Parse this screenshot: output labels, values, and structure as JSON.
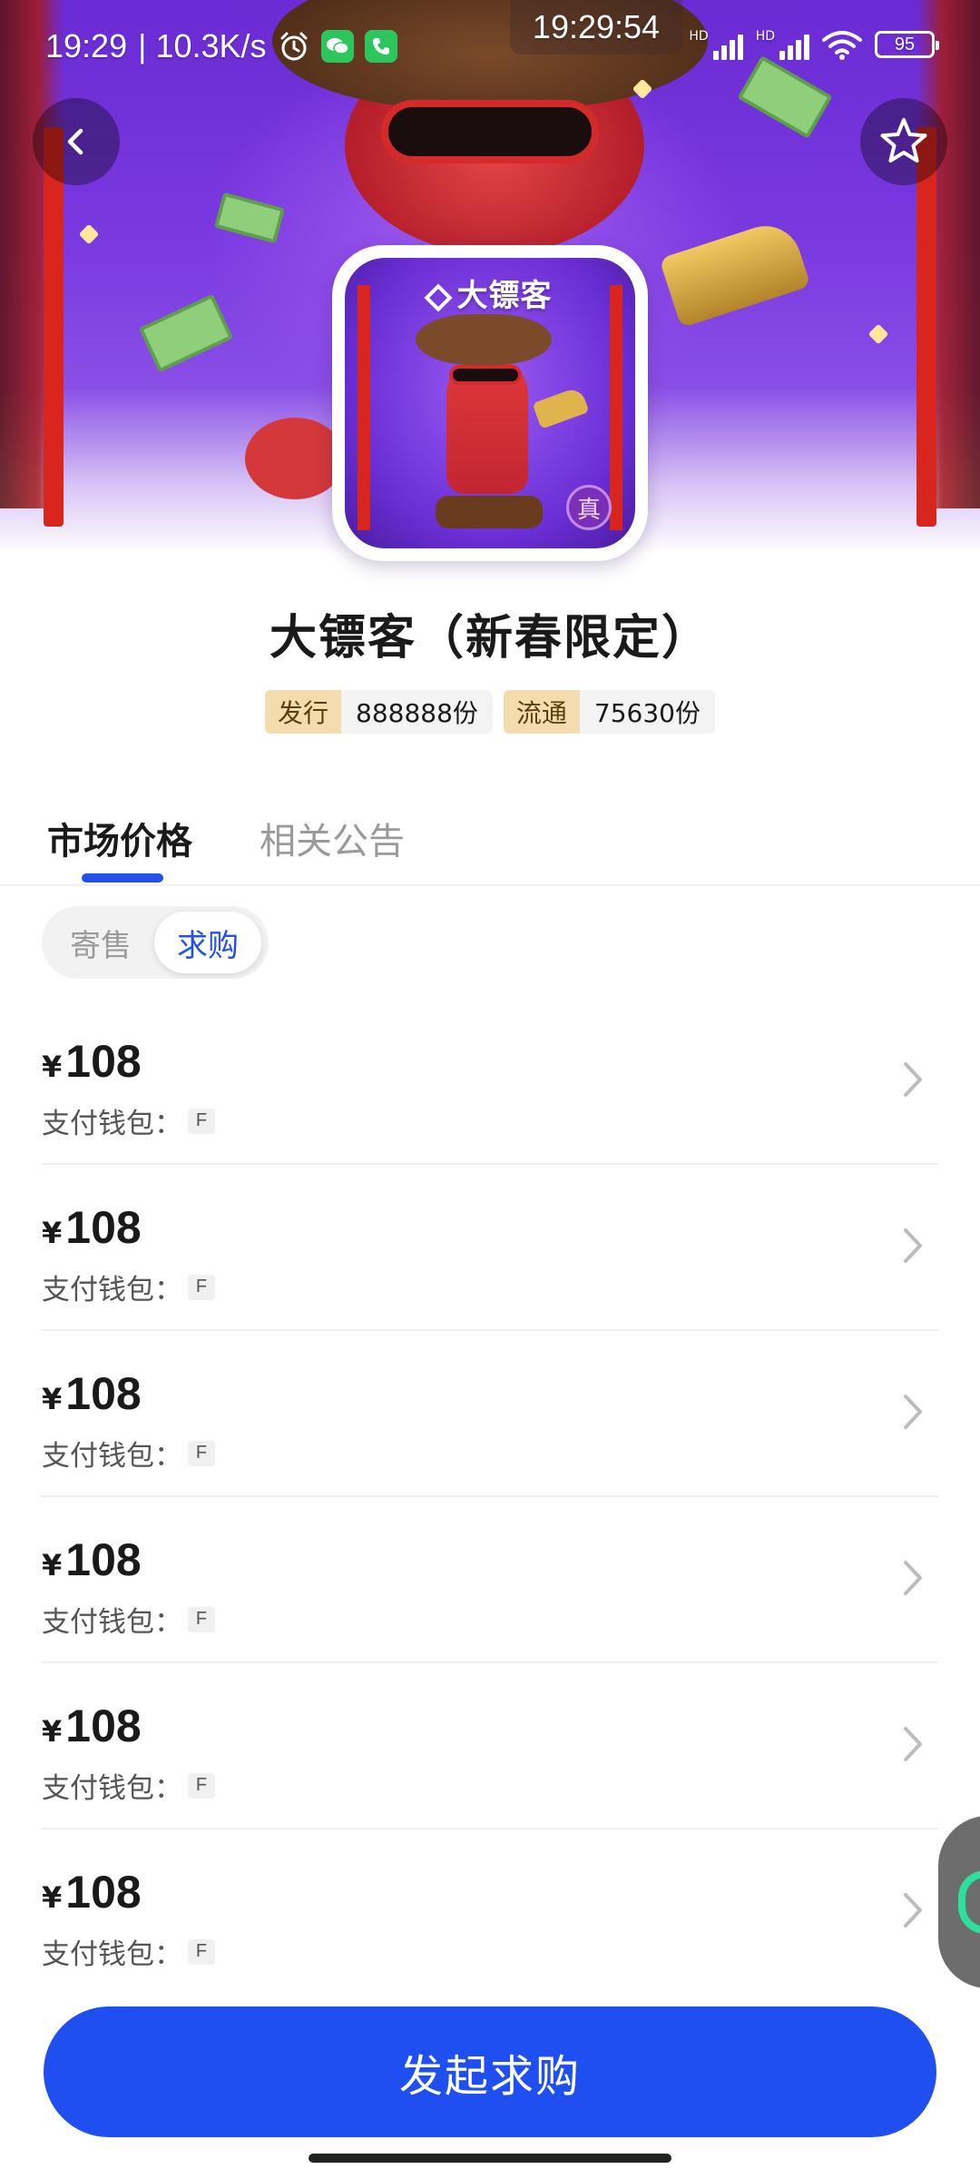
{
  "status_bar": {
    "time": "19:29",
    "net_speed": "| 10.3K/s",
    "center_time": "19:29:54",
    "battery": "95",
    "signal_label_1": "HD",
    "signal_label_2": "HD"
  },
  "product": {
    "title": "大镖客（新春限定）",
    "thumbnail_logo": "大镖客",
    "thumbnail_seal": "真",
    "issued_label": "发行",
    "issued_value": "888888份",
    "circulation_label": "流通",
    "circulation_value": "75630份"
  },
  "tabs": [
    {
      "label": "市场价格",
      "active": true
    },
    {
      "label": "相关公告",
      "active": false
    }
  ],
  "segment": {
    "sell_label": "寄售",
    "buy_label": "求购",
    "selected": "求购"
  },
  "listings": [
    {
      "currency": "¥",
      "price": "108",
      "wallet_label": "支付钱包：",
      "wallet_tag": "F"
    },
    {
      "currency": "¥",
      "price": "108",
      "wallet_label": "支付钱包：",
      "wallet_tag": "F"
    },
    {
      "currency": "¥",
      "price": "108",
      "wallet_label": "支付钱包：",
      "wallet_tag": "F"
    },
    {
      "currency": "¥",
      "price": "108",
      "wallet_label": "支付钱包：",
      "wallet_tag": "F"
    },
    {
      "currency": "¥",
      "price": "108",
      "wallet_label": "支付钱包：",
      "wallet_tag": "F"
    },
    {
      "currency": "¥",
      "price": "108",
      "wallet_label": "支付钱包：",
      "wallet_tag": "F"
    }
  ],
  "cta": {
    "label": "发起求购"
  },
  "icons": {
    "back": "chevron-left-icon",
    "favorite": "star-outline-icon",
    "row_arrow": "chevron-right-icon",
    "alarm": "alarm-icon",
    "wechat": "wechat-icon",
    "phone": "phone-icon",
    "wifi": "wifi-icon"
  },
  "colors": {
    "accent": "#2350ea",
    "cta": "#1f4ff0",
    "badge_key_bg": "#f3dcae",
    "hero_purple": "#7b3ae0"
  }
}
